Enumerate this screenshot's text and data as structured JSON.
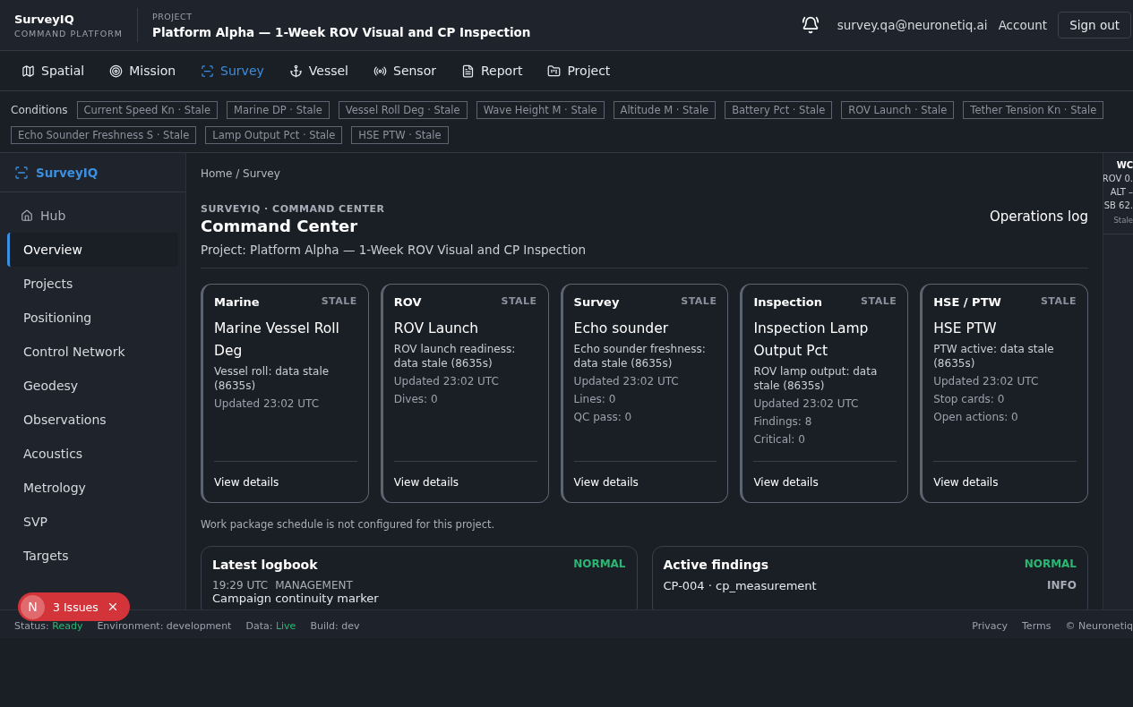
{
  "header": {
    "brand": "SurveyIQ",
    "subtitle": "COMMAND PLATFORM",
    "project_label": "PROJECT",
    "project_title": "Platform Alpha — 1-Week ROV Visual and CP Inspection",
    "email": "survey.qa@neuronetiq.ai",
    "account": "Account",
    "sign_out": "Sign out"
  },
  "nav": [
    {
      "label": "Spatial",
      "selected": false
    },
    {
      "label": "Mission",
      "selected": false
    },
    {
      "label": "Survey",
      "selected": true
    },
    {
      "label": "Vessel",
      "selected": false
    },
    {
      "label": "Sensor",
      "selected": false
    },
    {
      "label": "Report",
      "selected": false
    },
    {
      "label": "Project",
      "selected": false
    }
  ],
  "conditions": {
    "label": "Conditions",
    "chips": [
      "Current Speed Kn · Stale",
      "Marine DP · Stale",
      "Vessel Roll Deg · Stale",
      "Wave Height M · Stale",
      "Altitude M · Stale",
      "Battery Pct · Stale",
      "ROV Launch · Stale",
      "Tether Tension Kn · Stale",
      "Echo Sounder Freshness S · Stale",
      "Lamp Output Pct · Stale",
      "HSE PTW · Stale"
    ]
  },
  "sidebar": {
    "brand": "SurveyIQ",
    "items": [
      {
        "label": "Hub",
        "kind": "hub",
        "selected": false
      },
      {
        "label": "Overview",
        "kind": "link",
        "selected": true
      },
      {
        "label": "Projects",
        "kind": "link",
        "selected": false
      },
      {
        "label": "Positioning",
        "kind": "link",
        "selected": false
      },
      {
        "label": "Control Network",
        "kind": "link",
        "selected": false
      },
      {
        "label": "Geodesy",
        "kind": "link",
        "selected": false
      },
      {
        "label": "Observations",
        "kind": "link",
        "selected": false
      },
      {
        "label": "Acoustics",
        "kind": "link",
        "selected": false
      },
      {
        "label": "Metrology",
        "kind": "link",
        "selected": false
      },
      {
        "label": "SVP",
        "kind": "link",
        "selected": false
      },
      {
        "label": "Targets",
        "kind": "link",
        "selected": false
      }
    ]
  },
  "main": {
    "breadcrumb": "Home / Survey",
    "eyebrow": "SURVEYIQ · COMMAND CENTER",
    "title": "Command Center",
    "operations_log": "Operations log",
    "project_line": "Project: Platform Alpha — 1-Week ROV Visual and CP Inspection",
    "cards": [
      {
        "category": "Marine",
        "status": "STALE",
        "title": "Marine Vessel Roll Deg",
        "description": "Vessel roll: data stale (8635s)",
        "updated": "Updated 23:02 UTC",
        "link": "View details"
      },
      {
        "category": "ROV",
        "status": "STALE",
        "title": "ROV Launch",
        "description": "ROV launch readiness: data stale (8635s)",
        "updated": "Updated 23:02 UTC",
        "stats": [
          "Dives: 0"
        ],
        "link": "View details"
      },
      {
        "category": "Survey",
        "status": "STALE",
        "title": "Echo sounder",
        "description": "Echo sounder freshness: data stale (8635s)",
        "updated": "Updated 23:02 UTC",
        "stats": [
          "Lines: 0",
          "QC pass: 0"
        ],
        "link": "View details"
      },
      {
        "category": "Inspection",
        "status": "STALE",
        "title": "Inspection Lamp Output Pct",
        "description": "ROV lamp output: data stale (8635s)",
        "updated": "Updated 23:02 UTC",
        "stats": [
          "Findings: 8",
          "Critical: 0"
        ],
        "link": "View details"
      },
      {
        "category": "HSE / PTW",
        "status": "STALE",
        "title": "HSE PTW",
        "description": "PTW active: data stale (8635s)",
        "updated": "Updated 23:02 UTC",
        "stats": [
          "Stop cards: 0",
          "Open actions: 0"
        ],
        "link": "View details"
      }
    ],
    "schedule_note": "Work package schedule is not configured for this project.",
    "logbook": {
      "title": "Latest logbook",
      "status": "NORMAL",
      "time": "19:29 UTC",
      "category": "MANAGEMENT",
      "entry": "Campaign continuity marker"
    },
    "findings": {
      "title": "Active findings",
      "status": "NORMAL",
      "item": "CP-004 · cp_measurement",
      "severity": "INFO"
    }
  },
  "rail": {
    "title": "WC",
    "lines": [
      "ROV 0.",
      "ALT –",
      "SB 62."
    ],
    "status": "Stale"
  },
  "footer": {
    "status_label": "Status:",
    "status": "Ready",
    "environment": "Environment: development",
    "data_label": "Data:",
    "data": "Live",
    "build": "Build: dev",
    "links": [
      "Privacy",
      "Terms",
      "© Neuronetiq"
    ]
  },
  "issues": {
    "letter": "N",
    "label": "3 Issues"
  }
}
